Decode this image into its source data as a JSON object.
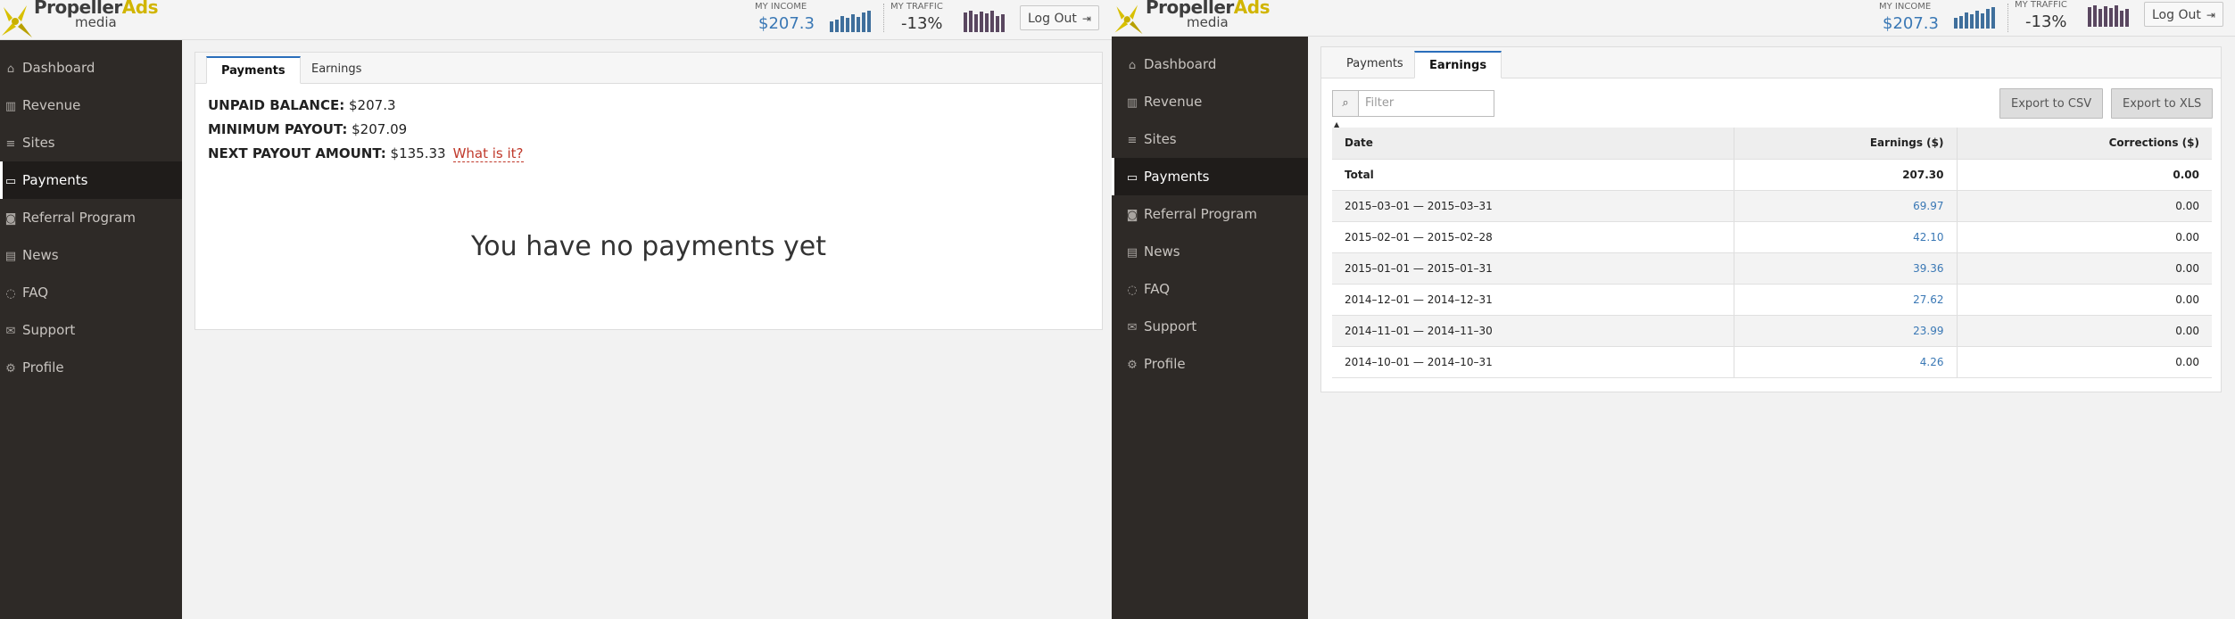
{
  "logo": {
    "brand": "Propeller",
    "brand_accent": "Ads",
    "sub": "media"
  },
  "header": {
    "income_label": "MY INCOME",
    "income_value": "$207.3",
    "traffic_label": "MY TRAFFIC",
    "traffic_value": "-13%",
    "logout_label": "Log Out",
    "colors": {
      "income": "#3a78b5",
      "traffic_bars": "#5a4760",
      "income_bars": "#3f6f9c"
    }
  },
  "sidebar": {
    "items": [
      {
        "label": "Dashboard",
        "icon": "home-icon"
      },
      {
        "label": "Revenue",
        "icon": "bar-chart-icon"
      },
      {
        "label": "Sites",
        "icon": "list-icon"
      },
      {
        "label": "Payments",
        "icon": "credit-card-icon",
        "active": true
      },
      {
        "label": "Referral Program",
        "icon": "money-icon"
      },
      {
        "label": "News",
        "icon": "newspaper-icon"
      },
      {
        "label": "FAQ",
        "icon": "comment-icon"
      },
      {
        "label": "Support",
        "icon": "envelope-icon"
      },
      {
        "label": "Profile",
        "icon": "gears-icon"
      }
    ]
  },
  "tabs": {
    "payments": "Payments",
    "earnings": "Earnings"
  },
  "payments": {
    "unpaid_label": "UNPAID BALANCE:",
    "unpaid_value": "$207.3",
    "min_label": "MINIMUM PAYOUT:",
    "min_value": "$207.09",
    "next_label": "NEXT PAYOUT AMOUNT:",
    "next_value": "$135.33",
    "what_link": "What is it?",
    "empty_message": "You have no payments yet"
  },
  "earnings": {
    "filter_placeholder": "Filter",
    "export_csv": "Export to CSV",
    "export_xls": "Export to XLS",
    "columns": [
      "Date",
      "Earnings ($)",
      "Corrections ($)"
    ],
    "total": {
      "date": "Total",
      "earnings": "207.30",
      "corrections": "0.00"
    },
    "rows": [
      {
        "date": "2015–03–01 — 2015–03–31",
        "earnings": "69.97",
        "corrections": "0.00"
      },
      {
        "date": "2015–02–01 — 2015–02–28",
        "earnings": "42.10",
        "corrections": "0.00"
      },
      {
        "date": "2015–01–01 — 2015–01–31",
        "earnings": "39.36",
        "corrections": "0.00"
      },
      {
        "date": "2014–12–01 — 2014–12–31",
        "earnings": "27.62",
        "corrections": "0.00"
      },
      {
        "date": "2014–11–01 — 2014–11–30",
        "earnings": "23.99",
        "corrections": "0.00"
      },
      {
        "date": "2014–10–01 — 2014–10–31",
        "earnings": "4.26",
        "corrections": "0.00"
      }
    ]
  }
}
